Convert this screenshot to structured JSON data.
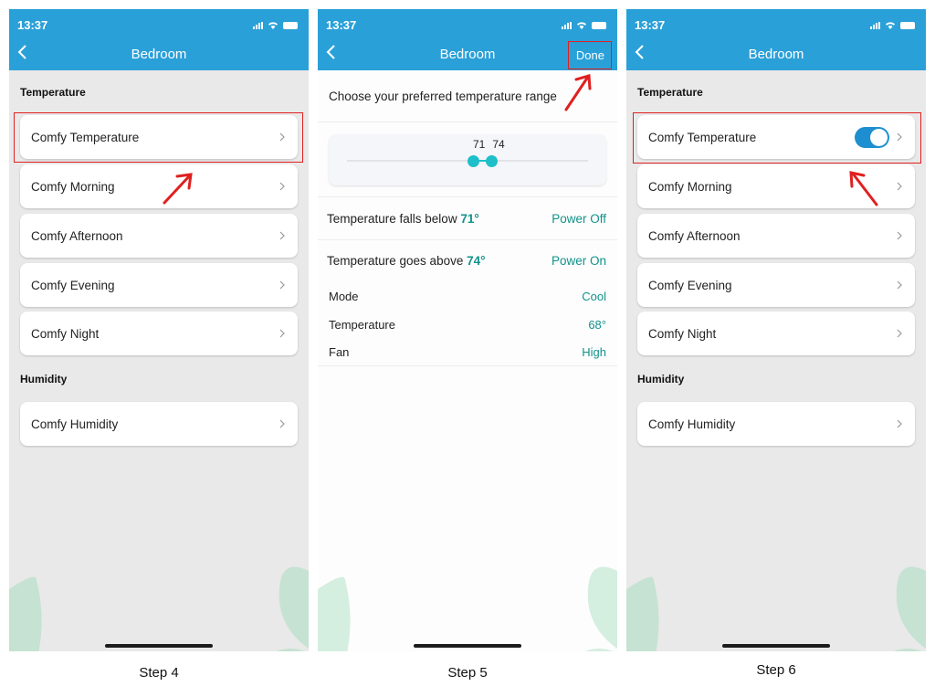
{
  "status_time": "13:37",
  "screens": {
    "step4": {
      "title": "Bedroom",
      "caption": "Step 4",
      "sections": [
        {
          "label": "Temperature",
          "items": [
            "Comfy Temperature",
            "Comfy Morning",
            "Comfy Afternoon",
            "Comfy Evening",
            "Comfy Night"
          ]
        },
        {
          "label": "Humidity",
          "items": [
            "Comfy Humidity"
          ]
        }
      ]
    },
    "step5": {
      "title": "Bedroom",
      "done_label": "Done",
      "caption": "Step 5",
      "prompt": "Choose your preferred temperature range",
      "slider": {
        "low": "71",
        "high": "74",
        "low_value": 71,
        "high_value": 74,
        "min": 50,
        "max": 90
      },
      "below": {
        "text": "Temperature falls below ",
        "value": "71°",
        "action": "Power Off"
      },
      "above": {
        "text": "Temperature goes above ",
        "value": "74°",
        "action": "Power On"
      },
      "settings": [
        {
          "label": "Mode",
          "value": "Cool"
        },
        {
          "label": "Temperature",
          "value": "68°"
        },
        {
          "label": "Fan",
          "value": "High"
        }
      ]
    },
    "step6": {
      "title": "Bedroom",
      "caption": "Step 6",
      "comfy_temperature_enabled": true,
      "sections": [
        {
          "label": "Temperature",
          "items": [
            "Comfy Temperature",
            "Comfy Morning",
            "Comfy Afternoon",
            "Comfy Evening",
            "Comfy Night"
          ]
        },
        {
          "label": "Humidity",
          "items": [
            "Comfy Humidity"
          ]
        }
      ]
    }
  },
  "colors": {
    "header": "#2aa0d8",
    "accent_teal": "#11928a",
    "toggle_on": "#1d8fd0",
    "annotation_red": "#e02020"
  }
}
